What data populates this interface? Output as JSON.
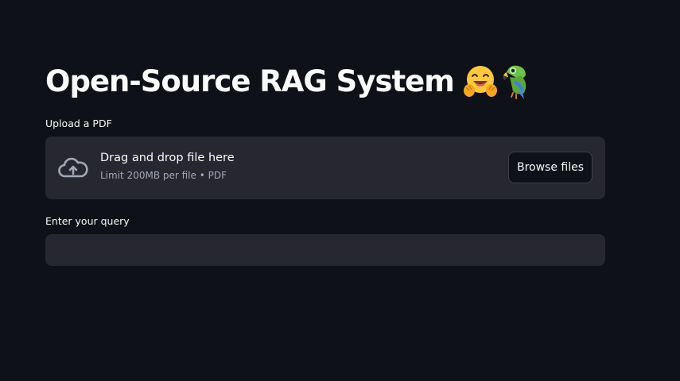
{
  "header": {
    "title": "Open-Source RAG System",
    "title_emojis": [
      "hugging-face-emoji",
      "parrot-emoji"
    ]
  },
  "upload": {
    "label": "Upload a PDF",
    "dropzone_title": "Drag and drop file here",
    "dropzone_limit": "Limit 200MB per file • PDF",
    "browse_label": "Browse files",
    "icon": "cloud-upload-icon"
  },
  "query": {
    "label": "Enter your query",
    "value": "",
    "placeholder": ""
  },
  "colors": {
    "background": "#0e1117",
    "surface": "#262730",
    "text": "#fafafa",
    "muted_text": "#a3a8b8"
  }
}
